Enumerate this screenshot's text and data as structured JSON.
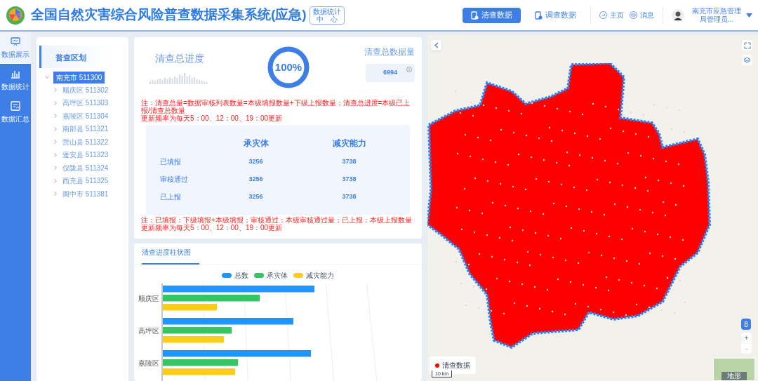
{
  "header": {
    "title": "全国自然灾害综合风险普查数据采集系统(应急)",
    "badge_lines": [
      "数据统计",
      "中　心"
    ],
    "nav": [
      {
        "label": "清查数据",
        "selected": true
      },
      {
        "label": "调查数据",
        "selected": false
      }
    ],
    "links": [
      "主页",
      "消息"
    ],
    "user": "南充市应急管理局管理员..."
  },
  "sidebar": [
    {
      "label": "数据展示",
      "selected": true
    },
    {
      "label": "数据统计",
      "selected": false
    },
    {
      "label": "数据汇总",
      "selected": false
    }
  ],
  "tree": {
    "title": "普查区划",
    "root": {
      "label": "南充市 511300",
      "selected": true,
      "expanded": true,
      "children": [
        {
          "label": "顺庆区 511302",
          "expanded": false
        },
        {
          "label": "高坪区 511303",
          "expanded": false
        },
        {
          "label": "嘉陵区 511304",
          "expanded": false
        },
        {
          "label": "南部县 511321",
          "expanded": false
        },
        {
          "label": "营山县 511322",
          "expanded": false
        },
        {
          "label": "蓬安县 511323",
          "expanded": false
        },
        {
          "label": "仪陇县 511324",
          "expanded": false
        },
        {
          "label": "西充县 511325",
          "expanded": false
        },
        {
          "label": "阆中市 511381",
          "expanded": false
        }
      ]
    }
  },
  "summary": {
    "progress_title": "清查总进度",
    "progress_text": "100%",
    "level": 1,
    "total_title": "清查总数据量",
    "total_value": "6994",
    "note_1": [
      "注：清查总量=数据审核列表数量=本级填报数量+下级上报数量；清查总进度=本级已上报/清查总数量",
      "更新频率为每天5：00、12：00、19：00更新"
    ],
    "table": {
      "columns": [
        "承灾体",
        "减灾能力"
      ],
      "rows": [
        {
          "label": "已填报",
          "values": [
            "3256",
            "3738"
          ]
        },
        {
          "label": "审核通过",
          "values": [
            "3256",
            "3738"
          ]
        },
        {
          "label": "已上报",
          "values": [
            "3256",
            "3738"
          ]
        }
      ]
    },
    "note_2": [
      "注：已填报：下级填报+本级填报；审核通过：本级审核通过量；已上报：本级上报数量",
      "更新频率为每天5：00、12：00、19：00更新"
    ]
  },
  "chart_panel": {
    "tab": "清查进度柱状图",
    "legend": [
      {
        "name": "总数",
        "color": "#1e96ff"
      },
      {
        "name": "承灾体",
        "color": "#36c464"
      },
      {
        "name": "减灾能力",
        "color": "#fbcd17"
      }
    ],
    "categories": [
      "顺庆区",
      "高坪区",
      "嘉陵区"
    ]
  },
  "map": {
    "badge": "8",
    "zoom_in": "+",
    "zoom_out": "-",
    "legend": "清查数据",
    "scale": "10 km",
    "minimap_label": "地形"
  }
}
